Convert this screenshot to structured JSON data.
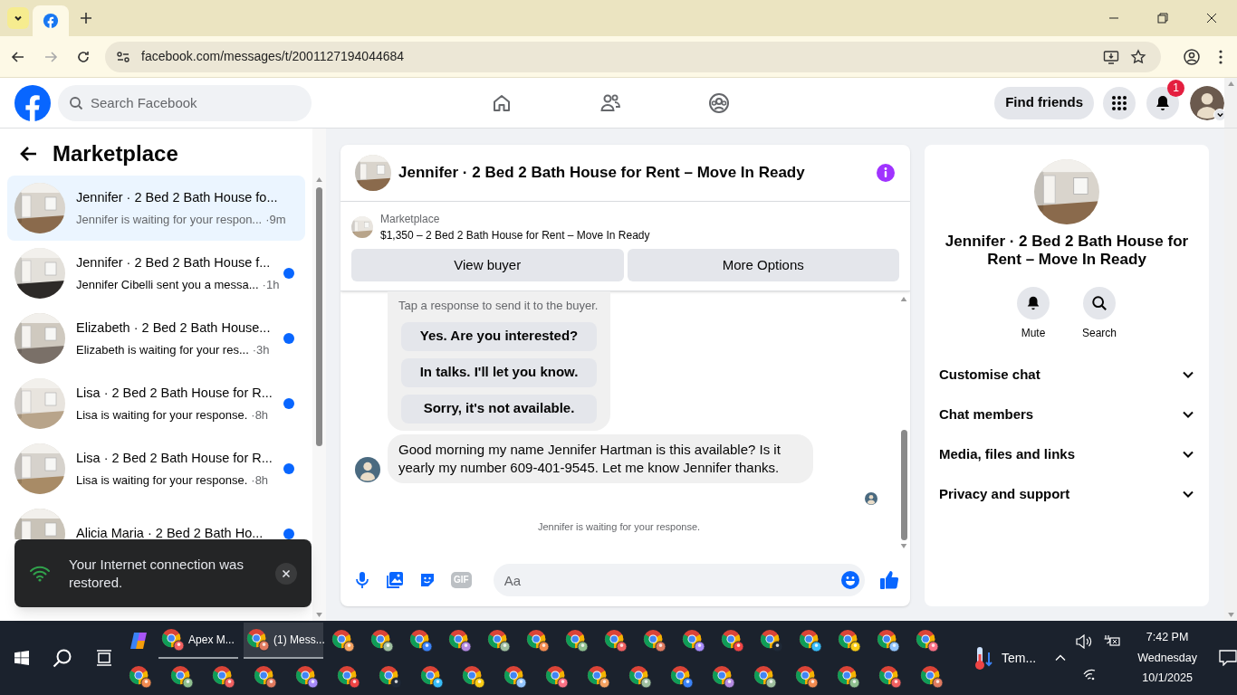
{
  "browser": {
    "url": "facebook.com/messages/t/2001127194044684"
  },
  "header": {
    "search_placeholder": "Search Facebook",
    "find_friends": "Find friends",
    "notifications_badge": "1"
  },
  "sidebar": {
    "title": "Marketplace",
    "conversations": [
      {
        "title": "Jennifer · 2 Bed 2 Bath House fo...",
        "preview": "Jennifer is waiting for your respon...",
        "time": "·9m",
        "selected": true,
        "unread": false
      },
      {
        "title": "Jennifer · 2 Bed 2 Bath House f...",
        "preview": "Jennifer Cibelli sent you a messa...",
        "time": "·1h",
        "selected": false,
        "unread": true
      },
      {
        "title": "Elizabeth · 2 Bed 2 Bath House...",
        "preview": "Elizabeth is waiting for your res...",
        "time": "·3h",
        "selected": false,
        "unread": true
      },
      {
        "title": "Lisa · 2 Bed 2 Bath House for R...",
        "preview": "Lisa is waiting for your response.",
        "time": "·8h",
        "selected": false,
        "unread": true
      },
      {
        "title": "Lisa · 2 Bed 2 Bath House for R...",
        "preview": "Lisa is waiting for your response.",
        "time": "·8h",
        "selected": false,
        "unread": true
      },
      {
        "title": "Alicia Maria · 2 Bed 2 Bath Ho...",
        "selected": false,
        "unread": true
      }
    ]
  },
  "toast": {
    "message": "Your Internet connection was restored."
  },
  "chat": {
    "title": "Jennifer · 2 Bed 2 Bath House for Rent – Move In Ready",
    "listing_label": "Marketplace",
    "listing_text": "$1,350 – 2 Bed 2 Bath House for Rent – Move In Ready",
    "actions": [
      "View buyer",
      "More Options"
    ],
    "quick_hint": "Tap a response to send it to the buyer.",
    "quick_responses": [
      "Yes. Are you interested?",
      "In talks. I'll let you know.",
      "Sorry, it's not available."
    ],
    "messages": [
      {
        "text": "Good morning my name Jennifer Hartman is this available? Is it yearly my number 609-401-9545. Let me know Jennifer thanks."
      }
    ],
    "status": "Jennifer is waiting for your response.",
    "composer": {
      "gif_label": "GIF",
      "placeholder": "Aa"
    }
  },
  "details": {
    "title": "Jennifer · 2 Bed 2 Bath House for Rent – Move In Ready",
    "actions": [
      {
        "label": "Mute",
        "kind": "bell"
      },
      {
        "label": "Search",
        "kind": "search"
      }
    ],
    "sections": [
      {
        "label": "Customise chat",
        "expanded": false
      },
      {
        "label": "Chat members",
        "expanded": false
      },
      {
        "label": "Media, files and links",
        "expanded": false
      },
      {
        "label": "Privacy and support",
        "expanded": false
      }
    ]
  },
  "taskbar": {
    "windows": [
      {
        "label": "Apex M...",
        "selected": false
      },
      {
        "label": "(1) Mess...",
        "selected": true
      }
    ],
    "weather": "Tem...",
    "time": "7:42 PM",
    "day": "Wednesday",
    "date": "10/1/2025"
  }
}
